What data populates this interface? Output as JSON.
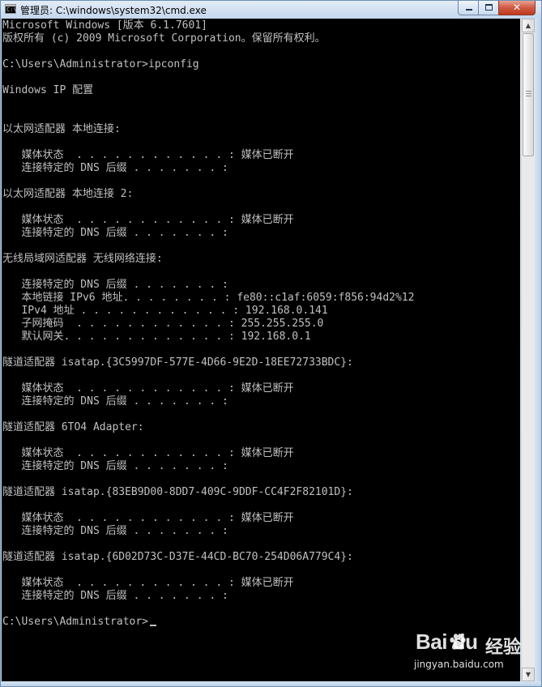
{
  "window": {
    "title": "管理员: C:\\windows\\system32\\cmd.exe",
    "icon_text": "C:\\",
    "minimize_icon": "minimize-icon",
    "maximize_icon": "maximize-icon",
    "close_glyph": "✕"
  },
  "console": {
    "text_color": "#c0c0c0",
    "background": "#000000",
    "lines": [
      "Microsoft Windows [版本 6.1.7601]",
      "版权所有 (c) 2009 Microsoft Corporation。保留所有权利。",
      "",
      "C:\\Users\\Administrator>ipconfig",
      "",
      "Windows IP 配置",
      "",
      "",
      "以太网适配器 本地连接:",
      "",
      "   媒体状态  . . . . . . . . . . . . : 媒体已断开",
      "   连接特定的 DNS 后缀 . . . . . . . :",
      "",
      "以太网适配器 本地连接 2:",
      "",
      "   媒体状态  . . . . . . . . . . . . : 媒体已断开",
      "   连接特定的 DNS 后缀 . . . . . . . :",
      "",
      "无线局域网适配器 无线网络连接:",
      "",
      "   连接特定的 DNS 后缀 . . . . . . . :",
      "   本地链接 IPv6 地址. . . . . . . . : fe80::c1af:6059:f856:94d2%12",
      "   IPv4 地址 . . . . . . . . . . . . : 192.168.0.141",
      "   子网掩码  . . . . . . . . . . . . : 255.255.255.0",
      "   默认网关. . . . . . . . . . . . . : 192.168.0.1",
      "",
      "隧道适配器 isatap.{3C5997DF-577E-4D66-9E2D-18EE72733BDC}:",
      "",
      "   媒体状态  . . . . . . . . . . . . : 媒体已断开",
      "   连接特定的 DNS 后缀 . . . . . . . :",
      "",
      "隧道适配器 6TO4 Adapter:",
      "",
      "   媒体状态  . . . . . . . . . . . . : 媒体已断开",
      "   连接特定的 DNS 后缀 . . . . . . . :",
      "",
      "隧道适配器 isatap.{83EB9D00-8DD7-409C-9DDF-CC4F2F82101D}:",
      "",
      "   媒体状态  . . . . . . . . . . . . : 媒体已断开",
      "   连接特定的 DNS 后缀 . . . . . . . :",
      "",
      "隧道适配器 isatap.{6D02D73C-D37E-44CD-BC70-254D06A779C4}:",
      "",
      "   媒体状态  . . . . . . . . . . . . : 媒体已断开",
      "   连接特定的 DNS 后缀 . . . . . . . :",
      "",
      "C:\\Users\\Administrator>"
    ]
  },
  "scrollbar": {
    "up_icon": "scroll-up-arrow-icon",
    "down_icon": "scroll-down-arrow-icon",
    "up_glyph": "▲",
    "down_glyph": "▼"
  },
  "watermark": {
    "brand": "Bai du",
    "paw_icon": "baidu-paw-icon",
    "jingyan": "经验",
    "url": "jingyan.baidu.com"
  }
}
